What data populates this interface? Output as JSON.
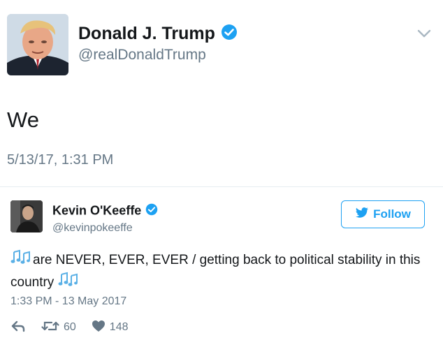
{
  "main_tweet": {
    "author_name": "Donald J. Trump",
    "author_handle": "@realDonaldTrump",
    "text": "We",
    "timestamp": "5/13/17, 1:31 PM",
    "icons": [
      "verified-badge-icon",
      "chevron-down-icon"
    ]
  },
  "reply_tweet": {
    "author_name": "Kevin O'Keeffe",
    "author_handle": "@kevinpokeeffe",
    "follow_label": "Follow",
    "text": "are NEVER, EVER, EVER / getting back to political stability in this country",
    "timestamp": "1:33 PM - 13 May 2017",
    "retweet_count": "60",
    "like_count": "148",
    "icons": [
      "verified-badge-icon",
      "twitter-bird-icon",
      "music-note-icon",
      "reply-icon",
      "retweet-icon",
      "heart-icon"
    ]
  },
  "colors": {
    "accent": "#1da1f2",
    "text": "#14171a",
    "muted": "#657786",
    "divider": "#e6ecf0"
  }
}
